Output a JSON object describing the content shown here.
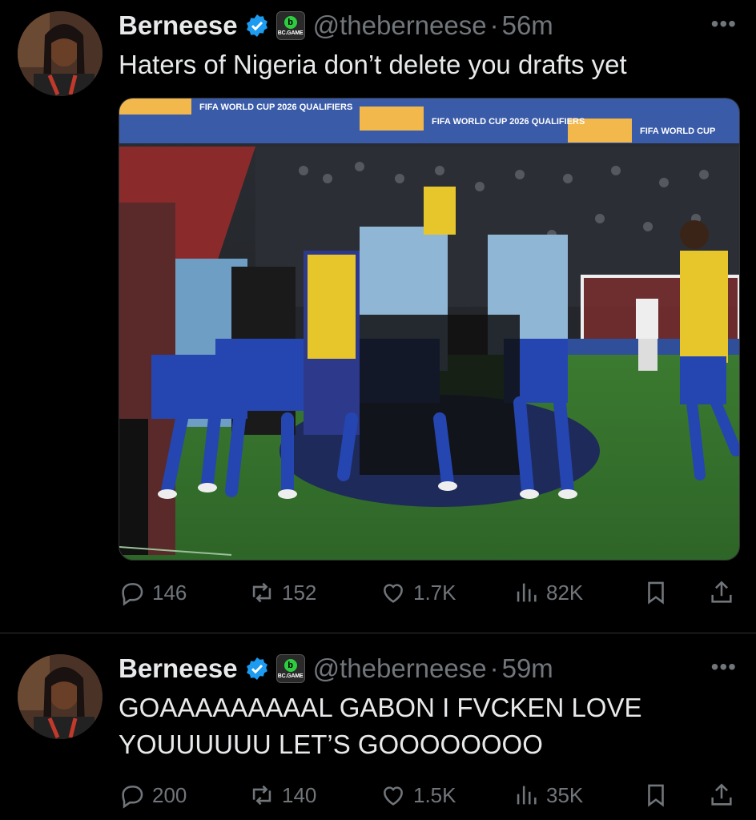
{
  "tweets": [
    {
      "display_name": "Berneese",
      "brand_badge": "BC.GAME",
      "handle": "@theberneese",
      "time": "56m",
      "text": "Haters of Nigeria don’t delete you drafts yet",
      "media_banner": [
        "FIFA WORLD CUP 2026 QUALIFIERS",
        "FIFA WORLD CUP 2026 QUALIFIERS",
        "FIFA WORLD CUP"
      ],
      "stats": {
        "replies": "146",
        "reposts": "152",
        "likes": "1.7K",
        "views": "82K"
      }
    },
    {
      "display_name": "Berneese",
      "brand_badge": "BC.GAME",
      "handle": "@theberneese",
      "time": "59m",
      "text_line1": "GOAAAAAAAAAL GABON I FVCKEN LOVE",
      "text_line2": "YOUUUUUU LET’S GOOOOOOOO",
      "stats": {
        "replies": "200",
        "reposts": "140",
        "likes": "1.5K",
        "views": "35K"
      }
    }
  ],
  "colors": {
    "background": "#000000",
    "text": "#e7e9ea",
    "muted": "#71767b",
    "verified": "#1d9bf0",
    "pitch": "#3f7d34"
  }
}
